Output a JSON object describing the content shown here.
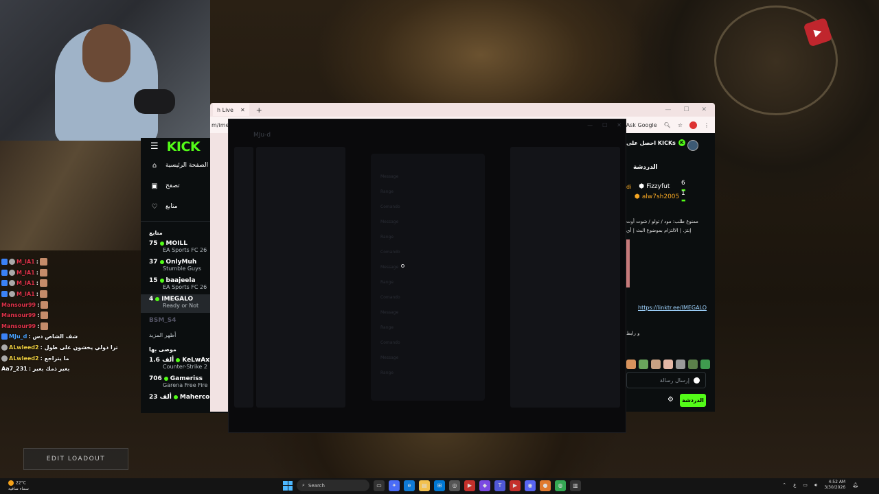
{
  "game": {
    "edit_loadout_label": "EDIT LOADOUT"
  },
  "stream_chat": [
    {
      "user": "M_IA1",
      "text": ":",
      "color": "red"
    },
    {
      "user": "M_IA1",
      "text": ":",
      "color": "red"
    },
    {
      "user": "M_IA1",
      "text": ":",
      "color": "red"
    },
    {
      "user": "M_IA1",
      "text": ":",
      "color": "red"
    },
    {
      "user": "Mansour99",
      "text": ":",
      "color": "red"
    },
    {
      "user": "Mansour99",
      "text": ":",
      "color": "red"
    },
    {
      "user": "Mansour99",
      "text": ":",
      "color": "red"
    },
    {
      "user": "MJu_d",
      "text": ": شف الشاص دس",
      "color": "blue"
    },
    {
      "user": "ALwleed2",
      "text": ": ترا دولي يخشون على طول",
      "color": "yellow"
    },
    {
      "user": "ALwleed2",
      "text": ": ما يتراجع",
      "color": "yellow"
    },
    {
      "user": "Aa7_231",
      "text": ": بغير ذمك بغير",
      "color": "white"
    }
  ],
  "kick_sidebar": {
    "logo": "KICK",
    "nav": [
      {
        "label": "الصفحة الرئيسية",
        "icon": "home-icon"
      },
      {
        "label": "تصفح",
        "icon": "browse-icon"
      },
      {
        "label": "متابع",
        "icon": "heart-icon"
      }
    ],
    "following_title": "متابع",
    "following": [
      {
        "viewers": "75",
        "name": "MOILL",
        "category": "EA Sports FC 26"
      },
      {
        "viewers": "37",
        "name": "OnlyMuh",
        "category": "Stumble Guys"
      },
      {
        "viewers": "15",
        "name": "baajeela",
        "category": "EA Sports FC 26"
      },
      {
        "viewers": "4",
        "name": "IMEGALO",
        "category": "Ready or Not"
      }
    ],
    "offline_channel": "BSM_S4",
    "show_more": "أظهر المزيد",
    "recommended_title": "موصى بها",
    "recommended": [
      {
        "viewers": "1.6 ألف",
        "name": "KeLwAxD",
        "category": "Counter-Strike 2"
      },
      {
        "viewers": "706",
        "name": "Gameriss",
        "category": "Garena Free Fire"
      },
      {
        "viewers": "23 ألف",
        "name": "Maherco",
        "category": ""
      }
    ]
  },
  "browser": {
    "tab_label": "h Live",
    "url_fragment": "m/imega",
    "ask_google": "Ask Google"
  },
  "discord": {
    "title": "MJu-d",
    "modal_fields": [
      "Message",
      "Range",
      "Comando",
      "Message",
      "Range",
      "Comando",
      "Message",
      "Range",
      "Comando",
      "Message",
      "Range",
      "Comando",
      "Message",
      "Range"
    ]
  },
  "kick_chat": {
    "get_kicks": "احصل على KICKs",
    "title": "الدردشة",
    "leaderboard": [
      {
        "name": "Fizzyfut",
        "rank": "6",
        "color": "#ffffff"
      },
      {
        "name": "alw7sh2005",
        "rank": "1",
        "color": "#f5a623"
      }
    ],
    "partial_user": "di",
    "messages": [
      "ممنوع طلب: مود / تولو / شوت أوت",
      "إنتز. | الالتزام بموضوع البث | أي",
      "و رابط"
    ],
    "link": "https://linktr.ee/IMEGALO",
    "input_placeholder": "إرسال رسالة",
    "send_label": "الدردشة"
  },
  "taskbar": {
    "weather_temp": "22°C",
    "weather_desc": "سماء صافية",
    "search_label": "Search",
    "time": "4:52 AM",
    "date": "3/30/2026",
    "lang": "ع"
  },
  "colors": {
    "kick_green": "#53fc18",
    "panel_bg": "#0b0e0f"
  }
}
